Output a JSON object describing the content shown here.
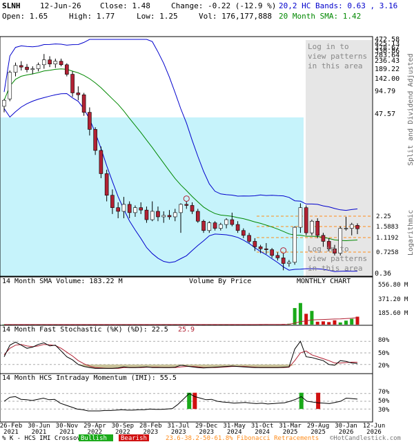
{
  "header": {
    "symbol": "SLNH",
    "date": "12-Jun-26",
    "close": "Close: 1.48",
    "change": "Change: -0.22 (-12.9 %)",
    "open": "Open: 1.65",
    "high": "High: 1.77",
    "low": "Low: 1.25",
    "vol": "Vol: 176,177,888",
    "bands": "20,2 HC Bands: 0.63 , 3.16",
    "sma": "20 Month SMA: 1.42"
  },
  "price_axis": {
    "ticks": [
      "472.58",
      "425.13",
      "378.67",
      "330.86",
      "283.64",
      "236.43",
      "189.22",
      "142.00",
      "94.79",
      "47.57",
      "0.36"
    ],
    "side_label": "Split and Dividend Adjusted",
    "side_label2": "Logarithmic",
    "fib_labels": [
      "2.25",
      "1.5883",
      "1.1192",
      "0.7258"
    ]
  },
  "overlays": {
    "login1": "Log in to view patterns in this area",
    "login2": "Log in to view patterns in this area"
  },
  "panel_labels": {
    "vol_sma": "14 Month SMA Volume: 183.22 M",
    "vbp": "Volume By Price",
    "monthly": "MONTHLY CHART",
    "vol_ticks": [
      "556.80 M",
      "371.20 M",
      "185.60 M"
    ],
    "stoch": "14 Month Fast Stochastic (%K) (%D): 22.5",
    "stoch_d": "25.9",
    "stoch_ticks": [
      "80%",
      "50%",
      "20%"
    ],
    "imi": "14 Month HCS Intraday Momentum (IMI): 55.5",
    "imi_ticks": [
      "70%",
      "50%",
      "30%"
    ]
  },
  "x_axis": {
    "labels": [
      "26-Feb 2021",
      "30-Jun 2021",
      "30-Nov 2021",
      "29-Apr 2022",
      "30-Sep 2022",
      "28-Feb 2023",
      "31-Jul 2023",
      "29-Dec 2023",
      "31-May 2024",
      "31-Oct 2024",
      "31-Mar 2025",
      "29-Aug 2025",
      "30-Jan 2026",
      "12-Jun 2026"
    ]
  },
  "footer": {
    "legend": "% K - HCS IMI Crossover:",
    "bullish": "Bullish",
    "bearish": "Bearish",
    "fib": "23.6-38.2-50-61.8% Fibonacci Retracements",
    "copyright": "©HotCandlestick.com"
  },
  "colors": {
    "up": "#2e8b57",
    "down": "#b22234",
    "band": "#0000cc",
    "sma": "#008800",
    "vbp": "#c6f3fb",
    "fib": "#ff8c1a",
    "green": "#1aaa1a",
    "red": "#d01010"
  },
  "chart_data": {
    "type": "candlestick",
    "months": 65,
    "price_log_range": [
      0.36,
      472.58
    ],
    "candles": [
      [
        60,
        75,
        50,
        72
      ],
      [
        75,
        180,
        70,
        170
      ],
      [
        170,
        230,
        150,
        210
      ],
      [
        210,
        240,
        180,
        200
      ],
      [
        200,
        220,
        170,
        185
      ],
      [
        185,
        205,
        160,
        190
      ],
      [
        190,
        230,
        175,
        215
      ],
      [
        215,
        300,
        190,
        250
      ],
      [
        250,
        280,
        200,
        220
      ],
      [
        220,
        260,
        195,
        240
      ],
      [
        240,
        260,
        205,
        215
      ],
      [
        215,
        225,
        150,
        160
      ],
      [
        160,
        175,
        80,
        90
      ],
      [
        90,
        110,
        72,
        85
      ],
      [
        85,
        90,
        45,
        50
      ],
      [
        50,
        58,
        25,
        30
      ],
      [
        30,
        32,
        14,
        16
      ],
      [
        16,
        18,
        7,
        8
      ],
      [
        8,
        9,
        3.5,
        4.2
      ],
      [
        4.2,
        5,
        2.4,
        2.9
      ],
      [
        2.9,
        3.4,
        2.1,
        2.6
      ],
      [
        2.6,
        4,
        2.1,
        3.2
      ],
      [
        3.2,
        3.5,
        2.1,
        2.5
      ],
      [
        2.5,
        3.1,
        2.2,
        2.9
      ],
      [
        2.9,
        3.4,
        2.4,
        2.7
      ],
      [
        2.7,
        3.0,
        1.8,
        2.0
      ],
      [
        2.0,
        3.5,
        1.9,
        2.6
      ],
      [
        2.6,
        3.0,
        1.9,
        2.2
      ],
      [
        2.2,
        2.6,
        1.8,
        2.3
      ],
      [
        2.3,
        2.7,
        2.0,
        2.2
      ],
      [
        2.2,
        2.8,
        1.9,
        2.5
      ],
      [
        2.5,
        3.3,
        1.3,
        3.2
      ],
      [
        3.2,
        3.5,
        2.8,
        3.1
      ],
      [
        3.1,
        3.4,
        2.4,
        2.6
      ],
      [
        2.6,
        2.8,
        1.8,
        1.9
      ],
      [
        1.9,
        2.0,
        1.3,
        1.4
      ],
      [
        1.4,
        1.9,
        1.3,
        1.8
      ],
      [
        1.8,
        1.9,
        1.4,
        1.5
      ],
      [
        1.5,
        1.8,
        1.4,
        1.7
      ],
      [
        1.7,
        2.1,
        1.5,
        2.0
      ],
      [
        2.0,
        2.5,
        1.6,
        1.7
      ],
      [
        1.7,
        1.9,
        1.3,
        1.4
      ],
      [
        1.4,
        1.5,
        1.1,
        1.2
      ],
      [
        1.2,
        1.3,
        0.95,
        1.0
      ],
      [
        1.0,
        1.1,
        0.75,
        0.85
      ],
      [
        0.85,
        0.9,
        0.7,
        0.8
      ],
      [
        0.8,
        0.95,
        0.68,
        0.78
      ],
      [
        0.78,
        0.82,
        0.6,
        0.65
      ],
      [
        0.65,
        0.72,
        0.55,
        0.6
      ],
      [
        0.6,
        0.7,
        0.4,
        0.5
      ],
      [
        0.5,
        0.56,
        0.45,
        0.52
      ],
      [
        0.52,
        1.6,
        0.48,
        1.55
      ],
      [
        1.55,
        3.3,
        1.3,
        2.9
      ],
      [
        2.9,
        3.1,
        1.2,
        1.3
      ],
      [
        1.3,
        2.0,
        1.2,
        1.9
      ],
      [
        1.9,
        2.1,
        1.1,
        1.2
      ],
      [
        1.2,
        1.3,
        0.85,
        1.0
      ],
      [
        1.0,
        1.1,
        0.75,
        0.8
      ],
      [
        0.8,
        0.9,
        0.65,
        0.7
      ],
      [
        0.7,
        1.6,
        0.65,
        1.5
      ],
      [
        1.5,
        2.2,
        1.4,
        1.5
      ],
      [
        1.5,
        1.8,
        1.2,
        1.7
      ],
      [
        1.65,
        1.77,
        1.25,
        1.48
      ]
    ],
    "volume": [
      0.6,
      0.5,
      0.8,
      0.7,
      0.5,
      0.4,
      0.6,
      0.5,
      0.6,
      0.5,
      0.4,
      0.5,
      0.6,
      0.5,
      0.6,
      0.7,
      0.6,
      0.7,
      0.8,
      0.6,
      0.6,
      0.6,
      0.5,
      0.5,
      0.6,
      0.5,
      0.8,
      0.6,
      0.5,
      0.6,
      0.6,
      0.7,
      0.9,
      0.7,
      0.8,
      0.9,
      0.7,
      0.8,
      0.9,
      1.0,
      1.1,
      2.0,
      3.0,
      2.5,
      4.0,
      3.0,
      6.0,
      5.0,
      4.0,
      8.0,
      12.0,
      230,
      300,
      150,
      190,
      40,
      45,
      35,
      60,
      30,
      55,
      80,
      110,
      180,
      176.2
    ],
    "stoch_k": [
      40,
      70,
      78,
      70,
      62,
      65,
      72,
      76,
      68,
      70,
      55,
      40,
      32,
      20,
      15,
      12,
      10,
      10,
      10,
      10,
      11,
      14,
      12,
      12,
      13,
      14,
      12,
      12,
      12,
      12,
      13,
      18,
      16,
      14,
      12,
      11,
      12,
      13,
      14,
      15,
      16,
      15,
      14,
      13,
      12,
      12,
      12,
      12,
      12,
      13,
      14,
      60,
      80,
      40,
      38,
      34,
      30,
      20,
      18,
      30,
      28,
      24,
      22.5
    ],
    "stoch_d": [
      45,
      62,
      70,
      72,
      68,
      66,
      68,
      72,
      71,
      69,
      62,
      52,
      42,
      30,
      22,
      16,
      12,
      11,
      10,
      10,
      10,
      12,
      12,
      12,
      12,
      13,
      13,
      13,
      12,
      12,
      12,
      14,
      15,
      15,
      14,
      12,
      12,
      12,
      13,
      14,
      15,
      15,
      15,
      14,
      13,
      12,
      12,
      12,
      12,
      12,
      13,
      30,
      50,
      55,
      45,
      40,
      35,
      30,
      24,
      24,
      25,
      26,
      25.9
    ],
    "imi": [
      50,
      60,
      62,
      55,
      54,
      52,
      55,
      58,
      54,
      55,
      45,
      40,
      35,
      30,
      28,
      25,
      25,
      25,
      26,
      26,
      27,
      28,
      27,
      27,
      28,
      28,
      30,
      29,
      29,
      30,
      31,
      42,
      56,
      70,
      62,
      58,
      54,
      55,
      50,
      48,
      47,
      45,
      46,
      47,
      45,
      44,
      45,
      43,
      44,
      45,
      46,
      50,
      55,
      62,
      50,
      48,
      46,
      45,
      44,
      47,
      50,
      58,
      57,
      55.5
    ],
    "imi_markers": [
      {
        "month": 33,
        "type": "bullish"
      },
      {
        "month": 34,
        "type": "bearish"
      },
      {
        "month": 53,
        "type": "bullish"
      },
      {
        "month": 56,
        "type": "bearish"
      }
    ],
    "fib_levels": [
      2.25,
      1.5883,
      1.1192,
      0.7258
    ],
    "circle_markers": [
      32,
      49
    ]
  }
}
